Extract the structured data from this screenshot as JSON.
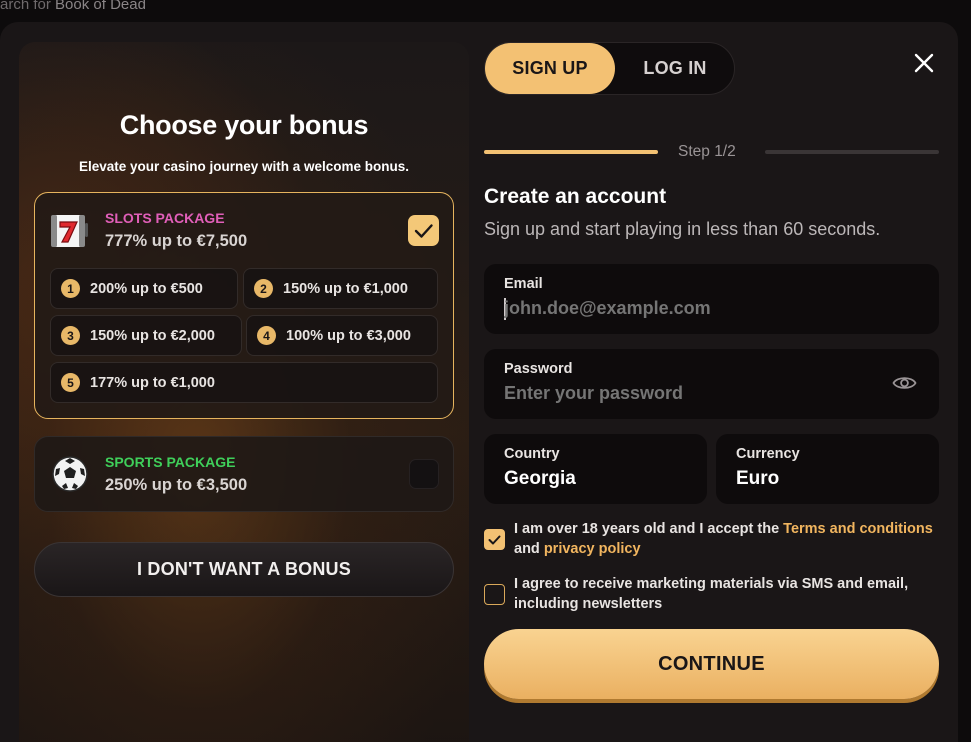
{
  "background": {
    "search_prefix": "arch for",
    "search_term": "Book of Dead"
  },
  "bonus_panel": {
    "title": "Choose your bonus",
    "subtitle": "Elevate your casino journey with a welcome bonus.",
    "slots_package": {
      "name": "SLOTS PACKAGE",
      "value": "777% up to €7,500",
      "checked": true,
      "icon": "slot-seven-icon",
      "tiers": [
        {
          "num": "1",
          "label": "200% up to €500"
        },
        {
          "num": "2",
          "label": "150% up to €1,000"
        },
        {
          "num": "3",
          "label": "150% up to €2,000"
        },
        {
          "num": "4",
          "label": "100% up to €3,000"
        },
        {
          "num": "5",
          "label": "177% up to €1,000"
        }
      ]
    },
    "sports_package": {
      "name": "SPORTS PACKAGE",
      "value": "250% up to €3,500",
      "checked": false,
      "icon": "soccer-ball-icon"
    },
    "no_bonus_label": "I DON'T WANT A BONUS"
  },
  "auth": {
    "tabs": [
      {
        "label": "SIGN UP",
        "active": true
      },
      {
        "label": "LOG IN",
        "active": false
      }
    ],
    "step_label": "Step 1/2",
    "progress": 0.5,
    "title": "Create an account",
    "subtitle": "Sign up and start playing in less than 60 seconds.",
    "email": {
      "label": "Email",
      "placeholder": "john.doe@example.com",
      "value": ""
    },
    "password": {
      "label": "Password",
      "placeholder": "Enter your password",
      "value": ""
    },
    "country": {
      "label": "Country",
      "value": "Georgia"
    },
    "currency": {
      "label": "Currency",
      "value": "Euro"
    },
    "age_consent": {
      "checked": true,
      "text_before": "I am over 18 years old and I accept the ",
      "terms_link": "Terms and conditions",
      "text_mid": " and ",
      "privacy_link": "privacy policy"
    },
    "marketing_consent": {
      "checked": false,
      "text": "I agree to receive marketing materials via SMS and email, including newsletters"
    },
    "continue_label": "CONTINUE"
  },
  "colors": {
    "accent": "#f3c173",
    "slots_name": "#e15fb9",
    "sports_name": "#3fcf5a",
    "link": "#f1b55f"
  }
}
